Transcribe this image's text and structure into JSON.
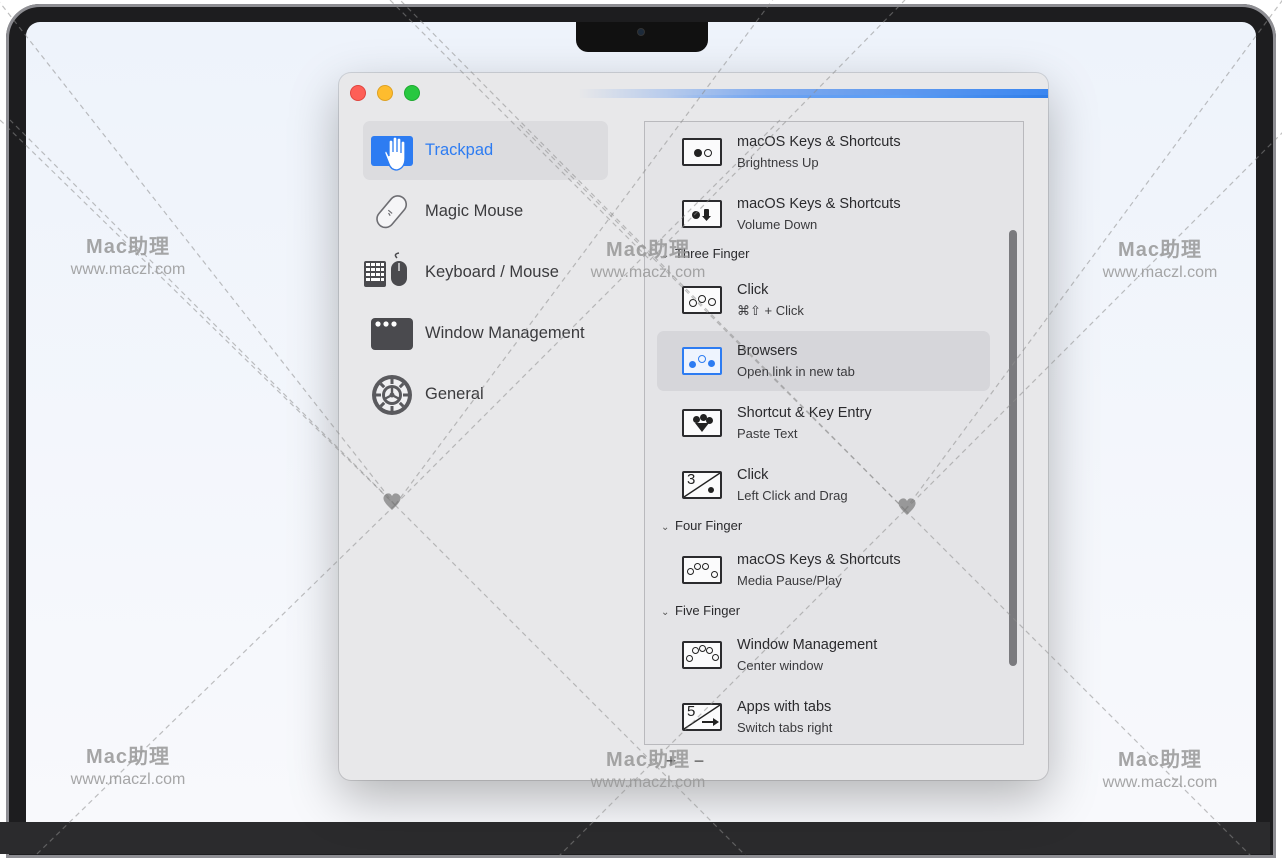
{
  "sidebar": {
    "items": [
      {
        "label": "Trackpad",
        "icon": "trackpad-hand-icon",
        "active": true
      },
      {
        "label": "Magic Mouse",
        "icon": "magic-mouse-icon",
        "active": false
      },
      {
        "label": "Keyboard / Mouse",
        "icon": "keyboard-mouse-icon",
        "active": false
      },
      {
        "label": "Window Management",
        "icon": "window-icon",
        "active": false
      },
      {
        "label": "General",
        "icon": "gear-icon",
        "active": false
      }
    ]
  },
  "gestures": {
    "rows": [
      {
        "title": "macOS Keys & Shortcuts",
        "subtitle": "Brightness Up",
        "icon": "two-finger-tap-icon"
      },
      {
        "title": "macOS Keys & Shortcuts",
        "subtitle": "Volume Down",
        "icon": "two-finger-swipe-down-icon"
      },
      {
        "title": "Click",
        "subtitle": "⌘⇧ + Click",
        "icon": "three-finger-click-icon"
      },
      {
        "title": "Browsers",
        "subtitle": "Open link in new tab",
        "icon": "three-finger-tap-icon",
        "selected": true
      },
      {
        "title": "Shortcut & Key Entry",
        "subtitle": "Paste Text",
        "icon": "three-finger-swipe-down-icon"
      },
      {
        "title": "Click",
        "subtitle": "Left Click and Drag",
        "icon": "three-finger-drag-icon"
      },
      {
        "title": "macOS Keys & Shortcuts",
        "subtitle": "Media Pause/Play",
        "icon": "four-finger-click-icon"
      },
      {
        "title": "Window Management",
        "subtitle": "Center window",
        "icon": "five-finger-click-icon"
      },
      {
        "title": "Apps with tabs",
        "subtitle": "Switch tabs right",
        "icon": "five-finger-swipe-right-icon"
      }
    ],
    "sections": {
      "three": "Three Finger",
      "four": "Four Finger",
      "five": "Five Finger"
    },
    "icon_digits": {
      "three": "3",
      "five": "5"
    }
  },
  "footer": {
    "add": "+",
    "remove": "−"
  },
  "watermark": {
    "brand": "Mac助理",
    "url": "www.maczl.com"
  },
  "colors": {
    "accent": "#2d7cf2",
    "close": "#fe5f57",
    "minimize": "#febc2e",
    "maximize": "#28c840"
  }
}
